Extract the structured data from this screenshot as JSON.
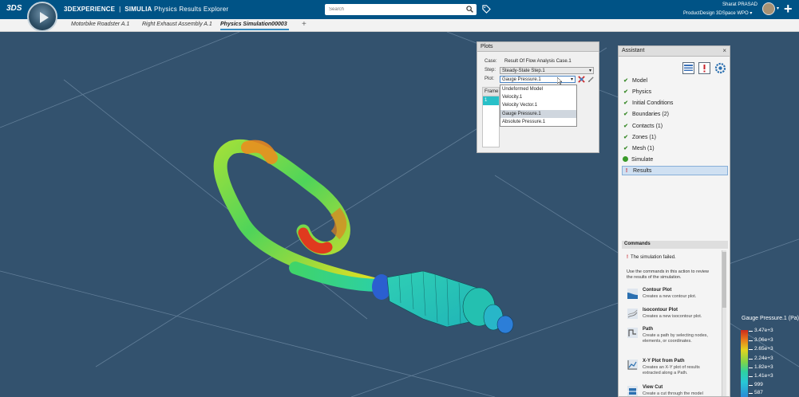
{
  "topbar": {
    "logo": "3DS",
    "app_brand": "3DEXPERIENCE",
    "app_suite": "SIMULIA",
    "app_name": "Physics Results Explorer",
    "search_placeholder": "Search",
    "user_name": "Sharat PRASAD",
    "workspace": "ProductDesign 3DSpace WPO"
  },
  "tabs": [
    {
      "label": "Motorbike Roadster A.1"
    },
    {
      "label": "Right Exhaust Assembly A.1"
    },
    {
      "label": "Physics Simulation00003 "
    }
  ],
  "tab_add": "+",
  "plots_panel": {
    "title": "Plots",
    "case_label": "Case:",
    "case_value": "Result Of Flow Analysis Case.1",
    "step_label": "Step:",
    "step_value": "Steady-State Step.1",
    "plot_label": "Plot:",
    "plot_value": "Gauge Pressure.1",
    "frame_header": "Frame",
    "frame_value": "1",
    "plot_options": [
      "Undeformed Model",
      "Velocity.1",
      "Velocity Vector.1",
      "Gauge Pressure.1",
      "Absolute Pressure.1"
    ],
    "selected_option": "Gauge Pressure.1"
  },
  "assistant": {
    "title": "Assistant",
    "close": "×",
    "steps": [
      {
        "label": "Model",
        "status": "done"
      },
      {
        "label": "Physics",
        "status": "done"
      },
      {
        "label": "Initial Conditions",
        "status": "done"
      },
      {
        "label": "Boundaries (2)",
        "status": "done"
      },
      {
        "label": "Contacts (1)",
        "status": "done"
      },
      {
        "label": "Zones (1)",
        "status": "done"
      },
      {
        "label": "Mesh (1)",
        "status": "done"
      },
      {
        "label": "Simulate",
        "status": "running"
      },
      {
        "label": "Results",
        "status": "error"
      }
    ],
    "commands_header": "Commands",
    "fail_message": "The simulation failed.",
    "fail_hint": "Use the commands in this action to review the results of the simulation.",
    "commands": [
      {
        "title": "Contour Plot",
        "desc": "Creates a new contour plot."
      },
      {
        "title": "Isocontour Plot",
        "desc": "Creates a new isocontour plot."
      },
      {
        "title": "Path",
        "desc": "Create a path by selecting nodes, elements, or coordinates."
      },
      {
        "title": "X-Y Plot from Path",
        "desc": "Creates an X-Y plot of results extracted along a Path."
      },
      {
        "title": "View Cut",
        "desc": "Create a cut through the model"
      }
    ]
  },
  "legend": {
    "title": "Gauge Pressure.1 (Pa)",
    "values": [
      "3.47e+3",
      "3.06e+3",
      "2.65e+3",
      "2.24e+3",
      "1.82e+3",
      "1.41e+3",
      "999",
      "587"
    ]
  },
  "colors": {
    "topbar": "#005386",
    "viewport": "#33526e",
    "accent": "#368ec4",
    "ok": "#3a8a2a",
    "error": "#c8222a"
  }
}
